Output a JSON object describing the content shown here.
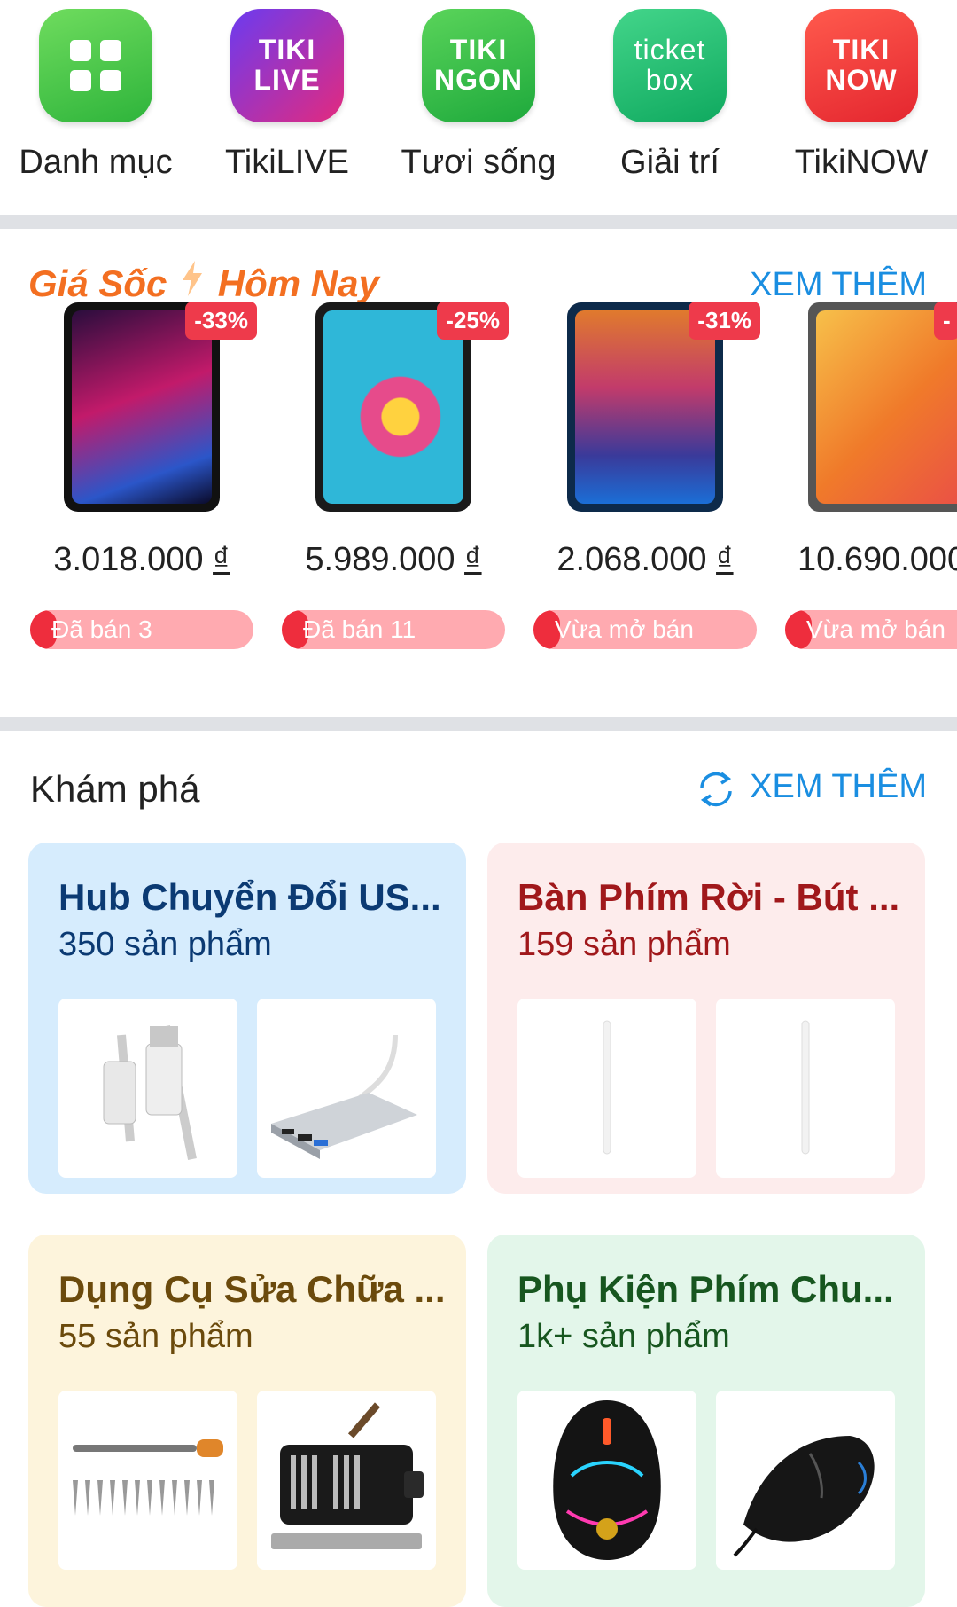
{
  "categories": [
    {
      "label": "Danh mục",
      "icon": "grid-icon",
      "color": "#45c94a",
      "icon_text": ""
    },
    {
      "label": "TikiLIVE",
      "icon": "tikilive-logo",
      "color": "#a02fd6",
      "icon_text": "TIKI LIVE"
    },
    {
      "label": "Tươi sống",
      "icon": "tiki-ngon-logo",
      "color": "#2fc24c",
      "icon_text": "TIKI NGON"
    },
    {
      "label": "Giải trí",
      "icon": "ticketbox-logo",
      "color": "#1fbf72",
      "icon_text": "ticket box"
    },
    {
      "label": "TikiNOW",
      "icon": "tikinow-logo",
      "color": "#f23b3b",
      "icon_text": "TIKI NOW"
    }
  ],
  "flash_sale": {
    "title_part1": "Giá Sốc",
    "title_part2": "Hôm Nay",
    "see_more": "XEM THÊM",
    "products": [
      {
        "discount": "-33%",
        "price": "3.018.000",
        "currency": "₫",
        "sold_label": "Đã bán 3",
        "sold_fraction": 0.12,
        "screen": "linear-gradient(160deg,#2a0d3d,#c21a6a 45%,#2b56c9 80%,#0a0a2a)"
      },
      {
        "discount": "-25%",
        "price": "5.989.000",
        "currency": "₫",
        "sold_label": "Đã bán 11",
        "sold_fraction": 0.12,
        "screen": "radial-gradient(circle at 55% 55%,#ffd23f 0 14%,#e64b8b 15% 30%,#2fb7d8 31%)"
      },
      {
        "discount": "-31%",
        "price": "2.068.000",
        "currency": "₫",
        "sold_label": "Vừa mở bán",
        "sold_fraction": 0.12,
        "screen": "linear-gradient(180deg,#e07a2d,#c23b6b 40%,#3a3a9a 75%,#1b6ed6)"
      },
      {
        "discount": "-",
        "price": "10.690.000",
        "currency": "₫",
        "sold_label": "Vừa mở bán",
        "sold_fraction": 0.12,
        "screen": "linear-gradient(135deg,#f7c04a,#f07a2a 50%,#e94a4a)"
      }
    ]
  },
  "explore": {
    "title": "Khám phá",
    "see_more": "XEM THÊM",
    "cards": [
      {
        "name": "Hub Chuyển Đổi US...",
        "count": "350 sản phẩm",
        "bg": "#d6ecfd",
        "color": "#0b3a73",
        "thumbs": [
          "usb-cable",
          "usb-c-hub"
        ]
      },
      {
        "name": "Bàn Phím Rời - Bút ...",
        "count": "159 sản phẩm",
        "bg": "#fdecec",
        "color": "#a0181b",
        "thumbs": [
          "stylus-pen",
          "stylus-pen"
        ]
      },
      {
        "name": "Dụng Cụ Sửa Chữa ...",
        "count": "55 sản phẩm",
        "bg": "#fdf4dc",
        "color": "#6b4a0c",
        "thumbs": [
          "screwdriver-set",
          "tool-kit"
        ]
      },
      {
        "name": "Phụ Kiện Phím Chu...",
        "count": "1k+ sản phẩm",
        "bg": "#e3f6ea",
        "color": "#17561f",
        "thumbs": [
          "gaming-mouse",
          "black-mouse"
        ]
      }
    ]
  }
}
